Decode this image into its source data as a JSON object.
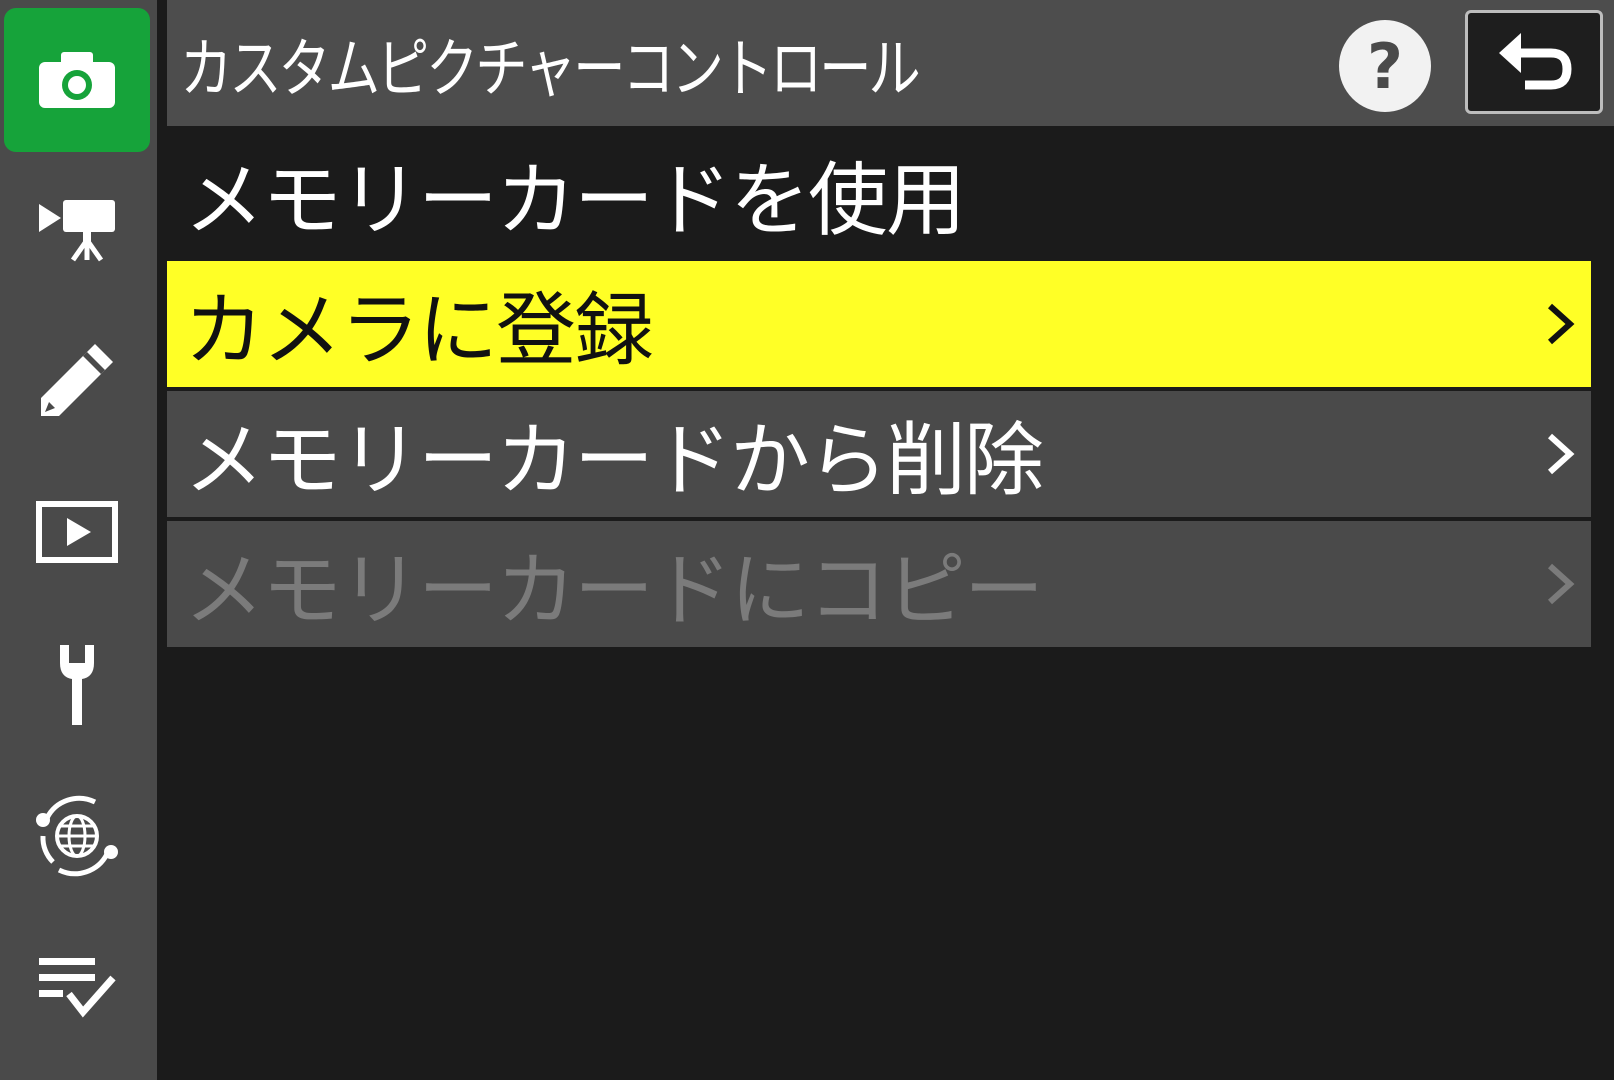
{
  "header": {
    "title": "カスタムピクチャーコントロール",
    "help_label": "?"
  },
  "sidebar": {
    "items": [
      {
        "icon": "camera-icon",
        "active": true
      },
      {
        "icon": "video-camera-icon",
        "active": false
      },
      {
        "icon": "pencil-icon",
        "active": false
      },
      {
        "icon": "playback-icon",
        "active": false
      },
      {
        "icon": "wrench-icon",
        "active": false
      },
      {
        "icon": "network-icon",
        "active": false
      },
      {
        "icon": "my-menu-icon",
        "active": false
      }
    ]
  },
  "menu": {
    "items": [
      {
        "label": "メモリーカードを使用",
        "state": "normal",
        "has_arrow": false
      },
      {
        "label": "カメラに登録",
        "state": "selected",
        "has_arrow": true
      },
      {
        "label": "メモリーカードから削除",
        "state": "normal",
        "has_arrow": true
      },
      {
        "label": "メモリーカードにコピー",
        "state": "disabled",
        "has_arrow": true
      }
    ]
  },
  "colors": {
    "accent_green": "#16a33a",
    "highlight_yellow": "#ffff26",
    "sidebar_gray": "#4a4a4a",
    "background": "#1b1b1b"
  }
}
